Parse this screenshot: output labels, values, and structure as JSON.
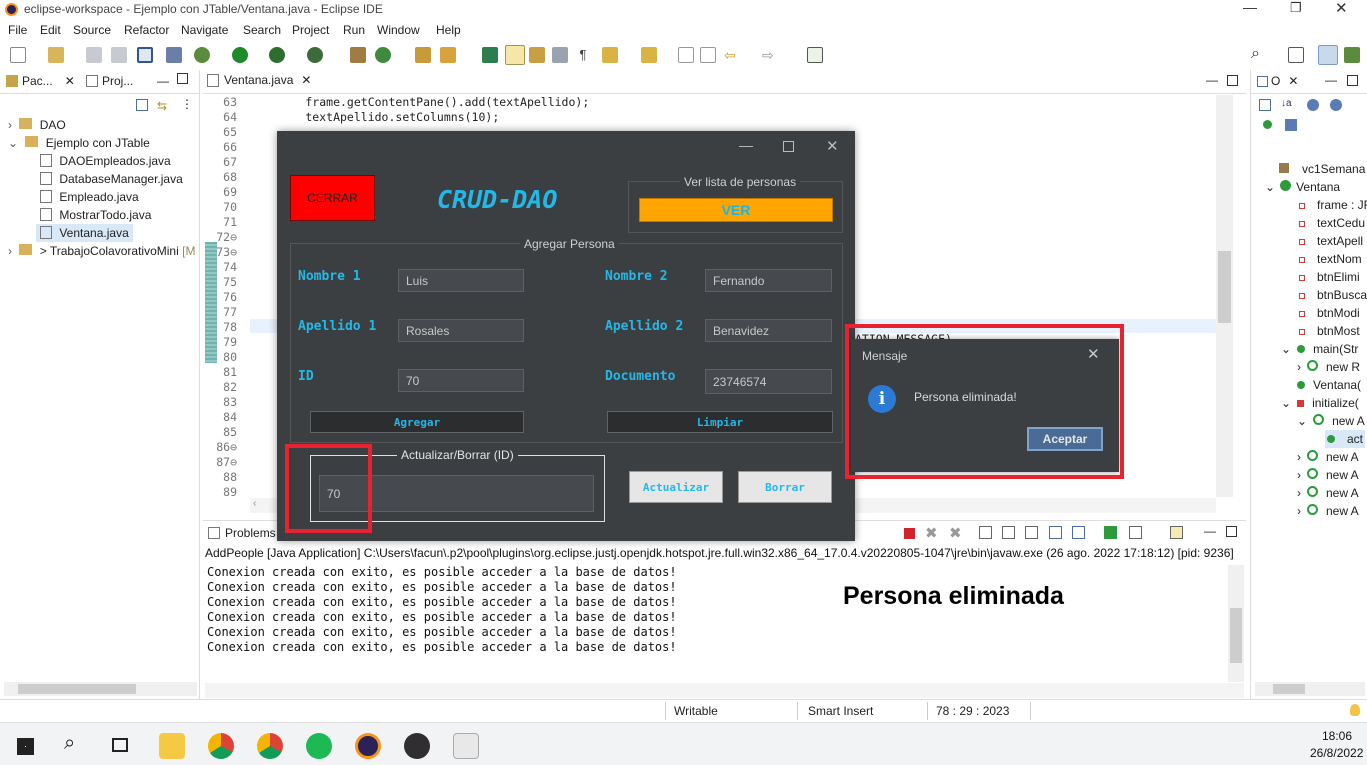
{
  "window": {
    "title": "eclipse-workspace - Ejemplo con JTable/Ventana.java - Eclipse IDE"
  },
  "menu": [
    "File",
    "Edit",
    "Source",
    "Refactor",
    "Navigate",
    "Search",
    "Project",
    "Run",
    "Window",
    "Help"
  ],
  "explorer": {
    "tab1": "Pac...",
    "tab2": "Proj...",
    "items": [
      {
        "label": "DAO",
        "indent": 0,
        "arrow": ">"
      },
      {
        "label": "Ejemplo con JTable",
        "indent": 0,
        "arrow": "v"
      },
      {
        "label": "DAOEmpleados.java",
        "indent": 2,
        "arrow": ""
      },
      {
        "label": "DatabaseManager.java",
        "indent": 2,
        "arrow": ""
      },
      {
        "label": "Empleado.java",
        "indent": 2,
        "arrow": ""
      },
      {
        "label": "MostrarTodo.java",
        "indent": 2,
        "arrow": ""
      },
      {
        "label": "Ventana.java",
        "indent": 2,
        "arrow": "",
        "selected": true
      },
      {
        "label": "> TrabajoColavorativoMini",
        "suffix": "[M",
        "indent": 0,
        "arrow": ">"
      }
    ]
  },
  "editor": {
    "tab": "Ventana.java",
    "lines": [
      {
        "n": "63",
        "code": "        frame.getContentPane().add(textApellido);"
      },
      {
        "n": "64",
        "code": "        textApellido.setColumns(10);"
      },
      {
        "n": "65",
        "code": ""
      },
      {
        "n": "66",
        "code": ""
      },
      {
        "n": "67",
        "code": ""
      },
      {
        "n": "68",
        "code": ""
      },
      {
        "n": "69",
        "code": ""
      },
      {
        "n": "70",
        "code": ""
      },
      {
        "n": "71",
        "code": ""
      },
      {
        "n": "72⊖",
        "code": ""
      },
      {
        "n": "73⊖",
        "code": ""
      },
      {
        "n": "74",
        "code": ""
      },
      {
        "n": "75",
        "code": ""
      },
      {
        "n": "76",
        "code": ""
      },
      {
        "n": "77",
        "code": ""
      },
      {
        "n": "78",
        "code": ""
      },
      {
        "n": "79",
        "code": ""
      },
      {
        "n": "80",
        "code": ""
      },
      {
        "n": "81",
        "code": ""
      },
      {
        "n": "82",
        "code": ""
      },
      {
        "n": "83",
        "code": ""
      },
      {
        "n": "84",
        "code": ""
      },
      {
        "n": "85",
        "code": ""
      },
      {
        "n": "86⊖",
        "code": ""
      },
      {
        "n": "87⊖",
        "code": ""
      },
      {
        "n": "88",
        "code": ""
      },
      {
        "n": "89",
        "code": ""
      }
    ],
    "peek_code": "ATION_MESSAGE)"
  },
  "outline": {
    "tab": "O",
    "items": [
      {
        "label": "vc1Semana",
        "indent": 1
      },
      {
        "label": "Ventana",
        "indent": 0
      },
      {
        "label": "frame : JF",
        "indent": 2
      },
      {
        "label": "textCedu",
        "indent": 2
      },
      {
        "label": "textApell",
        "indent": 2
      },
      {
        "label": "textNom",
        "indent": 2
      },
      {
        "label": "btnElimi",
        "indent": 2
      },
      {
        "label": "btnBusca",
        "indent": 2
      },
      {
        "label": "btnModi",
        "indent": 2
      },
      {
        "label": "btnMost",
        "indent": 2
      },
      {
        "label": "main(Str",
        "indent": 1
      },
      {
        "label": "new R",
        "indent": 2
      },
      {
        "label": "Ventana(",
        "indent": 1
      },
      {
        "label": "initialize(",
        "indent": 1
      },
      {
        "label": "new A",
        "indent": 2
      },
      {
        "label": "act",
        "indent": 3
      },
      {
        "label": "new A",
        "indent": 2
      },
      {
        "label": "new A",
        "indent": 2
      },
      {
        "label": "new A",
        "indent": 2
      },
      {
        "label": "new A",
        "indent": 2
      }
    ]
  },
  "console": {
    "tab": "Problems",
    "header": "AddPeople [Java Application] C:\\Users\\facun\\.p2\\pool\\plugins\\org.eclipse.justj.openjdk.hotspot.jre.full.win32.x86_64_17.0.4.v20220805-1047\\jre\\bin\\javaw.exe  (26 ago. 2022 17:18:12) [pid: 9236]",
    "lines": [
      "Conexion creada con exito, es posible acceder a la base de datos!",
      "Conexion creada con exito, es posible acceder a la base de datos!",
      "Conexion creada con exito, es posible acceder a la base de datos!",
      "Conexion creada con exito, es posible acceder a la base de datos!",
      "Conexion creada con exito, es posible acceder a la base de datos!",
      "Conexion creada con exito, es posible acceder a la base de datos!"
    ]
  },
  "annotation": "Persona eliminada",
  "status": {
    "writable": "Writable",
    "insert": "Smart Insert",
    "position": "78 : 29 : 2023"
  },
  "app": {
    "close_btn": "CERRAR",
    "title": "CRUD-DAO",
    "list_group": "Ver lista de personas",
    "ver_btn": "VER",
    "add_group": "Agregar Persona",
    "nombre1_label": "Nombre 1",
    "nombre1_value": "Luis",
    "nombre2_label": "Nombre 2",
    "nombre2_value": "Fernando",
    "apellido1_label": "Apellido 1",
    "apellido1_value": "Rosales",
    "apellido2_label": "Apellido 2",
    "apellido2_value": "Benavidez",
    "id_label": "ID",
    "id_value": "70",
    "doc_label": "Documento",
    "doc_value": "23746574",
    "agregar_btn": "Agregar",
    "limpiar_btn": "Limpiar",
    "update_group": "Actualizar/Borrar (ID)",
    "update_value": "70",
    "actualizar_btn": "Actualizar",
    "borrar_btn": "Borrar"
  },
  "dialog": {
    "title": "Mensaje",
    "message": "Persona eliminada!",
    "ok": "Aceptar"
  },
  "taskbar": {
    "time": "18:06",
    "date": "26/8/2022"
  },
  "colors": {
    "highlight": "#e8232f",
    "dark_bg": "#3c3f41",
    "accent_cyan": "#24b8e8",
    "ver_orange": "#ffa500",
    "cerrar_red": "#ff0000"
  }
}
